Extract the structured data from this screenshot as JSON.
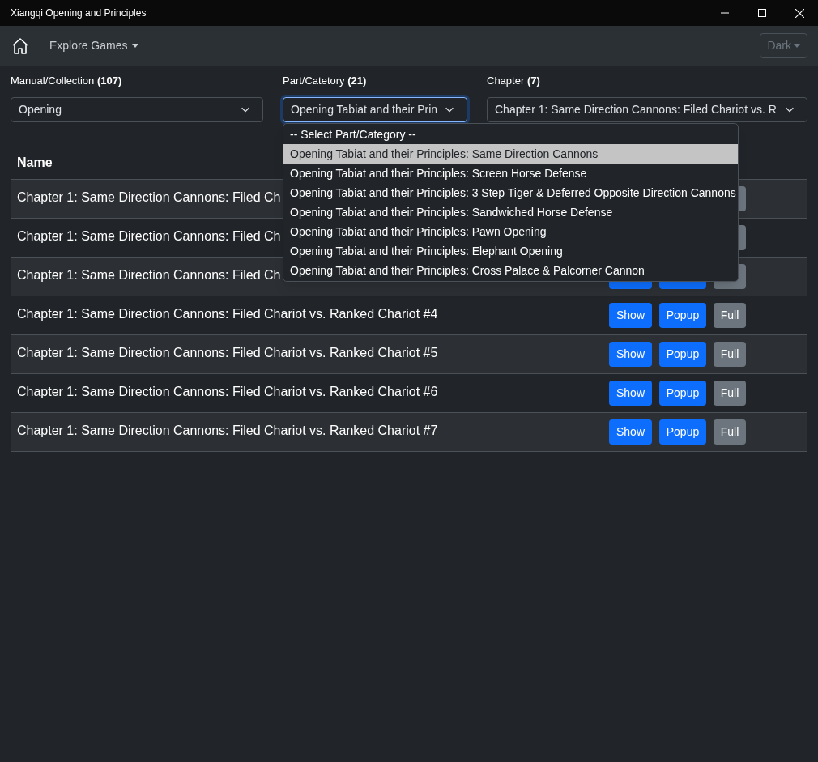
{
  "window": {
    "title": "Xiangqi Opening and Principles"
  },
  "navbar": {
    "menu": "Explore Games",
    "theme": "Dark"
  },
  "filters": [
    {
      "label": "Manual/Collection",
      "count": "(107)",
      "value": "Opening",
      "focused": false
    },
    {
      "label": "Part/Catetory",
      "count": "(21)",
      "value": "Opening Tabiat and their Prin",
      "focused": true
    },
    {
      "label": "Chapter",
      "count": "(7)",
      "value": "Chapter 1: Same Direction Cannons: Filed Chariot vs. R",
      "focused": false
    }
  ],
  "dropdown": {
    "options": [
      {
        "label": "-- Select Part/Category --",
        "selected": false
      },
      {
        "label": "Opening Tabiat and their Principles: Same Direction Cannons",
        "selected": true
      },
      {
        "label": "Opening Tabiat and their Principles: Screen Horse Defense",
        "selected": false
      },
      {
        "label": "Opening Tabiat and their Principles: 3 Step Tiger & Deferred Opposite Direction Cannons",
        "selected": false
      },
      {
        "label": "Opening Tabiat and their Principles: Sandwiched Horse Defense",
        "selected": false
      },
      {
        "label": "Opening Tabiat and their Principles: Pawn Opening",
        "selected": false
      },
      {
        "label": "Opening Tabiat and their Principles: Elephant Opening",
        "selected": false
      },
      {
        "label": "Opening Tabiat and their Principles: Cross Palace & Palcorner Cannon",
        "selected": false
      }
    ]
  },
  "table": {
    "columns": [
      "Name"
    ],
    "rows": [
      {
        "name": "Chapter 1: Same Direction Cannons: Filed Ch",
        "buttons": [
          {
            "kind": "full"
          }
        ]
      },
      {
        "name": "Chapter 1: Same Direction Cannons: Filed Ch",
        "buttons": [
          {
            "kind": "full"
          }
        ]
      },
      {
        "name": "Chapter 1: Same Direction Cannons: Filed Ch",
        "buttons": [
          {
            "kind": "show"
          },
          {
            "kind": "popup"
          },
          {
            "kind": "full"
          }
        ]
      },
      {
        "name": "Chapter 1: Same Direction Cannons: Filed Chariot vs. Ranked Chariot #4",
        "buttons": [
          {
            "kind": "show",
            "label": "Show"
          },
          {
            "kind": "popup",
            "label": "Popup"
          },
          {
            "kind": "full",
            "label": "Full"
          }
        ]
      },
      {
        "name": "Chapter 1: Same Direction Cannons: Filed Chariot vs. Ranked Chariot #5",
        "buttons": [
          {
            "kind": "show",
            "label": "Show"
          },
          {
            "kind": "popup",
            "label": "Popup"
          },
          {
            "kind": "full",
            "label": "Full"
          }
        ]
      },
      {
        "name": "Chapter 1: Same Direction Cannons: Filed Chariot vs. Ranked Chariot #6",
        "buttons": [
          {
            "kind": "show",
            "label": "Show"
          },
          {
            "kind": "popup",
            "label": "Popup"
          },
          {
            "kind": "full",
            "label": "Full"
          }
        ]
      },
      {
        "name": "Chapter 1: Same Direction Cannons: Filed Chariot vs. Ranked Chariot #7",
        "buttons": [
          {
            "kind": "show",
            "label": "Show"
          },
          {
            "kind": "popup",
            "label": "Popup"
          },
          {
            "kind": "full",
            "label": "Full"
          }
        ]
      }
    ]
  }
}
